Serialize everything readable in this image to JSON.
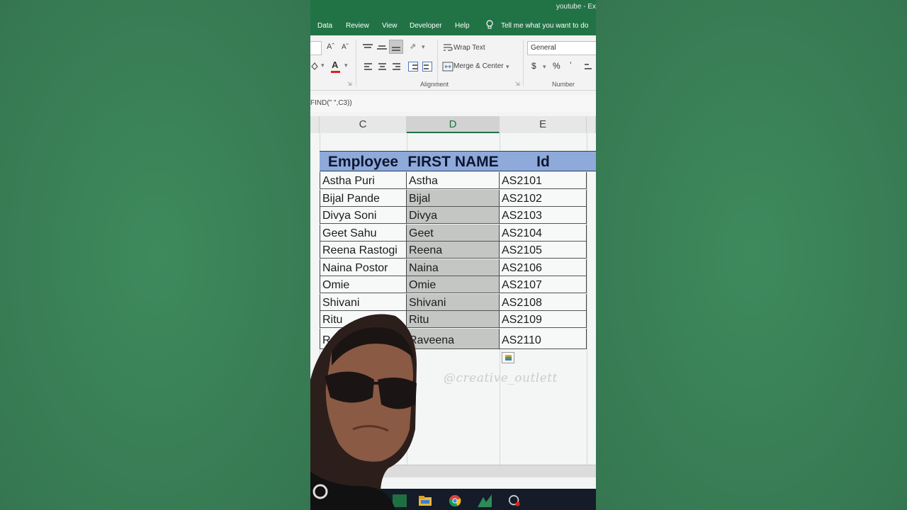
{
  "app": {
    "title": "youtube - Ex"
  },
  "menu": {
    "items": [
      "Data",
      "Review",
      "View",
      "Developer",
      "Help"
    ],
    "tell_me": "Tell me what you want to do"
  },
  "ribbon": {
    "wrap_text": "Wrap Text",
    "merge_center": "Merge & Center",
    "alignment_label": "Alignment",
    "number_format": "General",
    "number_label": "Number",
    "currency": "$",
    "percent": "%",
    "comma": "’"
  },
  "formula": {
    "text": "FIND(\" \",C3))"
  },
  "columns": [
    "C",
    "D",
    "E"
  ],
  "table": {
    "headers": [
      "Employee",
      "FIRST NAME",
      "Id"
    ],
    "rows": [
      [
        "Astha Puri",
        "Astha",
        "AS2101"
      ],
      [
        "Bijal Pande",
        "Bijal",
        "AS2102"
      ],
      [
        "Divya Soni",
        "Divya",
        "AS2103"
      ],
      [
        "Geet Sahu",
        "Geet",
        "AS2104"
      ],
      [
        "Reena Rastogi",
        "Reena",
        "AS2105"
      ],
      [
        "Naina Postor",
        "Naina",
        "AS2106"
      ],
      [
        "Omie",
        "Omie",
        "AS2107"
      ],
      [
        "Shivani",
        "Shivani",
        "AS2108"
      ],
      [
        "Ritu",
        "Ritu",
        "AS2109"
      ],
      [
        "Ra",
        "Raveena",
        "AS2110"
      ]
    ]
  },
  "watermark": "@creative_outlett",
  "colors": {
    "excel_green": "#217346",
    "header_fill": "#8eaadb",
    "selected_fill": "#c4c6c4",
    "background": "#3a7f57"
  }
}
